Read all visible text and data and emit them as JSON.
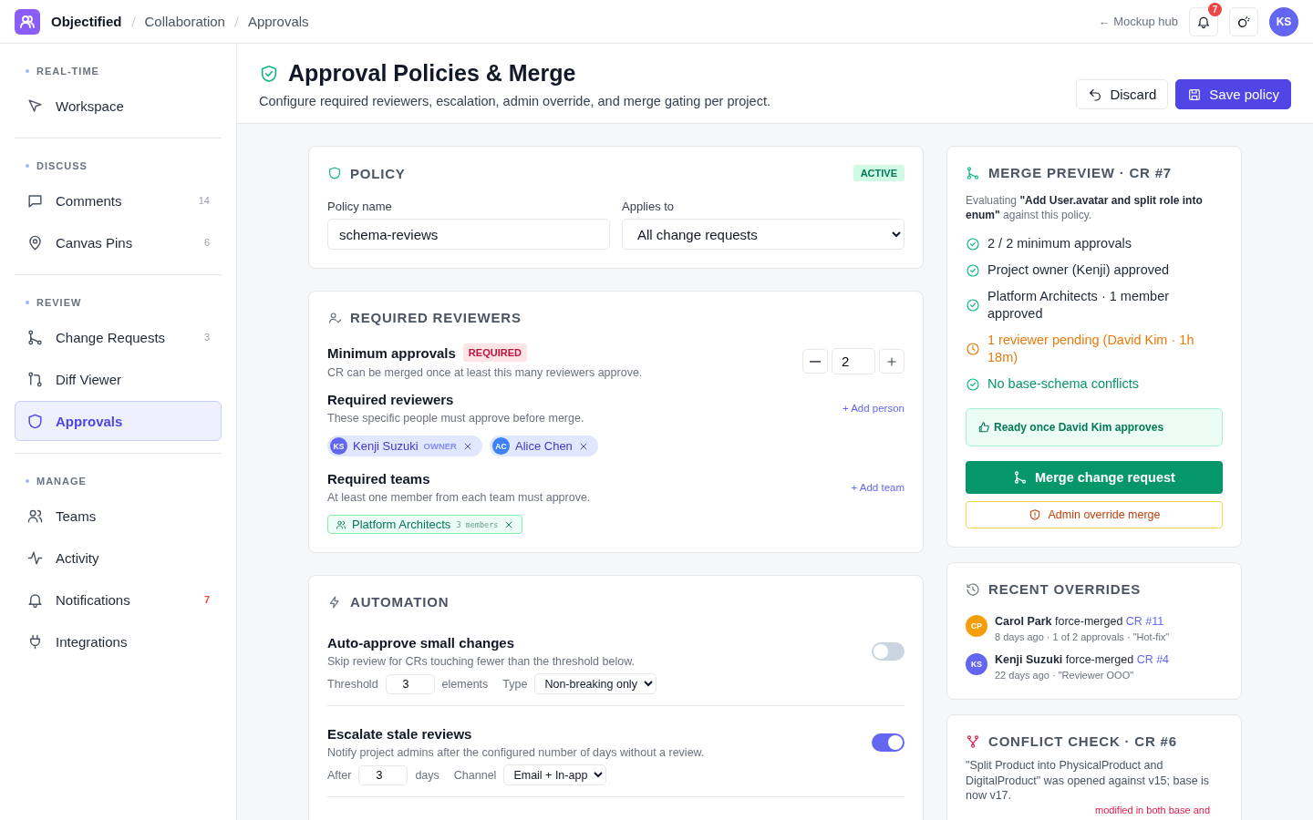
{
  "topbar": {
    "brand": "Objectified",
    "breadcrumbs": [
      "Collaboration",
      "Approvals"
    ],
    "hub_link": "← Mockup hub",
    "notification_count": "7",
    "avatar": "KS"
  },
  "sidebar": {
    "sections": [
      {
        "label": "REAL-TIME",
        "items": [
          {
            "label": "Workspace",
            "selected": false
          }
        ]
      },
      {
        "label": "DISCUSS",
        "items": [
          {
            "label": "Comments",
            "count": "14",
            "alert": false,
            "selected": false
          },
          {
            "label": "Canvas Pins",
            "count": "6",
            "alert": false,
            "selected": false
          }
        ]
      },
      {
        "label": "REVIEW",
        "items": [
          {
            "label": "Change Requests",
            "count": "3",
            "alert": false,
            "selected": false
          },
          {
            "label": "Diff Viewer",
            "selected": false
          },
          {
            "label": "Approvals",
            "selected": true
          }
        ]
      },
      {
        "label": "MANAGE",
        "items": [
          {
            "label": "Teams",
            "selected": false
          },
          {
            "label": "Activity",
            "selected": false
          },
          {
            "label": "Notifications",
            "count": "7",
            "alert": true,
            "selected": false
          },
          {
            "label": "Integrations",
            "selected": false
          }
        ]
      }
    ]
  },
  "header": {
    "title": "Approval Policies & Merge",
    "subtitle": "Configure required reviewers, escalation, admin override, and merge gating per project.",
    "discard": "Discard",
    "save": "Save policy"
  },
  "policy": {
    "title": "POLICY",
    "status": "ACTIVE",
    "name_label": "Policy name",
    "name_value": "schema-reviews",
    "applies_label": "Applies to",
    "applies_value": "All change requests"
  },
  "reviewers": {
    "title": "REQUIRED REVIEWERS",
    "minimum": {
      "title": "Minimum approvals",
      "badge": "REQUIRED",
      "description": "CR can be merged once at least this many reviewers approve.",
      "value": "2"
    },
    "people": {
      "title": "Required reviewers",
      "description": "These specific people must approve before merge.",
      "action": "+ Add person",
      "chips": [
        {
          "initials": "KS",
          "name": "Kenji Suzuki",
          "role": "OWNER",
          "color": "#6366f1"
        },
        {
          "initials": "AC",
          "name": "Alice Chen",
          "color": "#3b82f6"
        }
      ]
    },
    "teams": {
      "title": "Required teams",
      "description": "At least one member from each team must approve.",
      "action": "+ Add team",
      "chips": [
        {
          "name": "Platform Architects",
          "members": "3 members"
        }
      ]
    }
  },
  "automation": {
    "title": "AUTOMATION",
    "rules": [
      {
        "title": "Auto-approve small changes",
        "description": "Skip review for CRs touching fewer than the threshold below.",
        "on": false,
        "field_label": "Threshold",
        "field_value": "3",
        "unit": "elements",
        "select_label": "Type",
        "select_value": "Non-breaking only"
      },
      {
        "title": "Escalate stale reviews",
        "description": "Notify project admins after the configured number of days without a review.",
        "on": true,
        "field_label": "After",
        "field_value": "3",
        "unit": "days",
        "select_label": "Channel",
        "select_value": "Email + In-app"
      }
    ]
  },
  "merge_preview": {
    "title": "MERGE PREVIEW · CR #7",
    "intro": "Evaluating **\"Add User.avatar and split role into enum\"** against this policy.",
    "checks": [
      {
        "text": "2 / 2 minimum approvals",
        "kind": "passed"
      },
      {
        "text": "Project owner (Kenji) approved",
        "kind": "passed"
      },
      {
        "text": "Platform Architects · 1 member approved",
        "kind": "passed"
      },
      {
        "text": "1 reviewer pending (David Kim · 1h 18m)",
        "kind": "pending"
      },
      {
        "text": "No base-schema conflicts",
        "kind": "clear"
      }
    ],
    "ready": "Ready once David Kim approves",
    "merge_button": "Merge change request",
    "override_button": "Admin override merge"
  },
  "recent_overrides": {
    "title": "RECENT OVERRIDES",
    "items": [
      {
        "initials": "CP",
        "color": "#f59e0b",
        "text": "**Carol Park** force-merged",
        "link": "CR #11",
        "meta": "8 days ago · 1 of 2 approvals · \"Hot-fix\""
      },
      {
        "initials": "KS",
        "color": "#6366f1",
        "text": "**Kenji Suzuki** force-merged",
        "link": "CR #4",
        "meta": "22 days ago · \"Reviewer OOO\""
      }
    ]
  },
  "conflict_check": {
    "title": "CONFLICT CHECK · CR #6",
    "description": "\"Split Product into PhysicalProduct and DigitalProduct\" was opened against v15; base is now v17.",
    "note": "modified in both base and"
  }
}
